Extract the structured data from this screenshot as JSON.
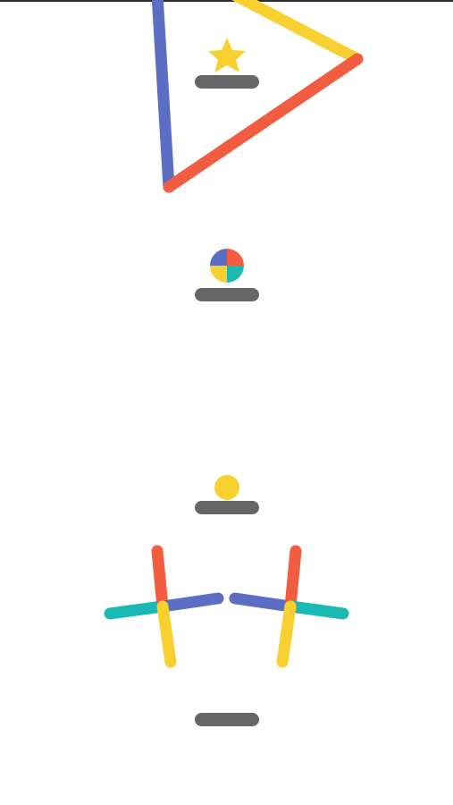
{
  "game": {
    "palette": {
      "blue": "#5B6EC4",
      "red": "#F25C41",
      "yellow": "#F8D131",
      "teal": "#1BB9B3",
      "platform": "#666666"
    },
    "objects": [
      {
        "kind": "triangle-obstacle",
        "segments": [
          "blue",
          "yellow",
          "red"
        ]
      },
      {
        "kind": "star-icon",
        "color": "yellow"
      },
      {
        "kind": "color-switcher",
        "quadrants": [
          "blue",
          "red",
          "yellow",
          "teal"
        ]
      },
      {
        "kind": "ball",
        "color": "yellow"
      },
      {
        "kind": "twin-cross-obstacle",
        "arms_left": [
          "red",
          "blue",
          "yellow",
          "teal"
        ],
        "arms_right": [
          "red",
          "teal",
          "yellow",
          "blue"
        ]
      },
      {
        "kind": "platform",
        "count": 4
      }
    ]
  }
}
